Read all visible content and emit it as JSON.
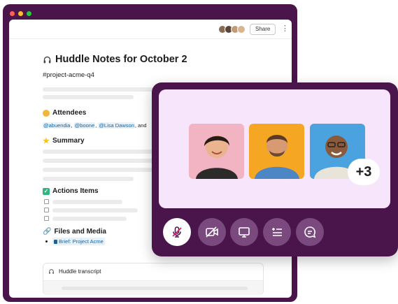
{
  "window": {
    "traffic_colors": [
      "#ff5f57",
      "#febc2e",
      "#28c840"
    ],
    "frame_color": "#4a154b"
  },
  "toolbar": {
    "share_label": "Share",
    "more_icon": "kebab-icon",
    "avatar_colors": [
      "#8a6a52",
      "#5a4636",
      "#c19a78",
      "#d9b48f"
    ]
  },
  "doc": {
    "title": "Huddle Notes for October 2",
    "title_icon": "headphones-icon",
    "channel": "#project-acme-q4",
    "attendees": {
      "heading": "Attendees",
      "icon": "heart-hands-emoji",
      "mentions": [
        "@abuendia",
        "@boone",
        "@Lisa Dawson"
      ],
      "separator": ", ",
      "and_text": ", and"
    },
    "summary": {
      "heading": "Summary",
      "icon": "star-emoji"
    },
    "actions": {
      "heading": "Actions Items",
      "icon": "check-box-emoji",
      "count": 3
    },
    "files": {
      "heading": "Files and Media",
      "icon": "link-icon",
      "items": [
        "Brief: Project Acme"
      ]
    },
    "transcript": {
      "label": "Huddle transcript",
      "icon": "headphones-icon"
    }
  },
  "huddle": {
    "participants": [
      {
        "name": "participant-1",
        "bg": "#f2b3c3"
      },
      {
        "name": "participant-2",
        "bg": "#f5a623"
      },
      {
        "name": "participant-3",
        "bg": "#4aa3df"
      }
    ],
    "overflow_label": "+3",
    "controls": [
      {
        "name": "mute-mic-button",
        "icon": "mic-off-icon",
        "active": true
      },
      {
        "name": "video-off-button",
        "icon": "video-off-icon",
        "active": false
      },
      {
        "name": "share-screen-button",
        "icon": "monitor-icon",
        "active": false
      },
      {
        "name": "notes-button",
        "icon": "list-icon",
        "active": false
      },
      {
        "name": "chat-button",
        "icon": "message-icon",
        "active": false
      }
    ]
  }
}
